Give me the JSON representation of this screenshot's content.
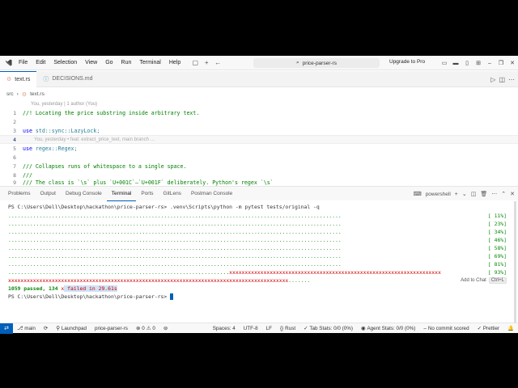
{
  "menu": [
    "File",
    "Edit",
    "Selection",
    "View",
    "Go",
    "Run",
    "Terminal",
    "Help"
  ],
  "command_center": "price-parser-rs",
  "upgrade_label": "Upgrade to Pro",
  "tabs": [
    {
      "label": "text.rs",
      "active": true
    },
    {
      "label": "DECISIONS.md",
      "active": false
    }
  ],
  "breadcrumb": [
    "src",
    "text.rs"
  ],
  "codelens": "You, yesterday | 1 author (You)",
  "editor_lines": [
    {
      "num": "1",
      "text": "//! Locating the price substring inside arbitrary text."
    },
    {
      "num": "2",
      "text": ""
    },
    {
      "num": "3",
      "kw": "use",
      "text": " std::sync::LazyLock;"
    },
    {
      "num": "4",
      "text": "",
      "blame": "You, yesterday • feat: extract_price_text, main branch …"
    },
    {
      "num": "5",
      "kw": "use",
      "text": " regex::Regex;"
    },
    {
      "num": "6",
      "text": ""
    },
    {
      "num": "7",
      "text": "/// Collapses runs of whitespace to a single space."
    },
    {
      "num": "8",
      "text": "///"
    },
    {
      "num": "9",
      "text": "/// The class is `\\s` plus `U+001C`–`U+001F` deliberately. Python's regex `\\s`"
    }
  ],
  "panel": {
    "tabs": [
      "Problems",
      "Output",
      "Debug Console",
      "Terminal",
      "Ports",
      "GitLens",
      "Postman Console"
    ],
    "active_tab": "Terminal",
    "shell": "powershell"
  },
  "terminal": {
    "command_line": "PS C:\\Users\\Dell\\Desktop\\hackathon\\price-parser-rs> .venv\\Scripts\\python -m pytest tests/original -q",
    "progress_percents": [
      "[ 11%]",
      "[ 23%]",
      "[ 34%]",
      "[ 46%]",
      "[ 58%]",
      "[ 69%]",
      "[ 81%]",
      "[ 93%]"
    ],
    "summary_passed": "1059 passed, 134",
    "summary_failed": " failed in 29.61s",
    "summary_mark": "x",
    "prompt": "PS C:\\Users\\Dell\\Desktop\\hackathon\\price-parser-rs> ",
    "add_to_chat": "Add to Chat",
    "add_to_chat_kbd": "Ctrl+L"
  },
  "status": {
    "branch": "main",
    "launchpad": "Launchpad",
    "project": "price-parser-rs",
    "problems": "0",
    "warnings": "0",
    "spaces": "Spaces: 4",
    "encoding": "UTF-8",
    "eol": "LF",
    "language": "Rust",
    "tab_stats": "Tab Stats: 0/0 (0%)",
    "agent_stats": "Agent Stats: 0/0 (0%)",
    "commit": "No commit scored",
    "prettier": "Prettier"
  },
  "colors": {
    "accent": "#005fb8",
    "pass": "#0a8a0a",
    "fail": "#cc0000"
  }
}
